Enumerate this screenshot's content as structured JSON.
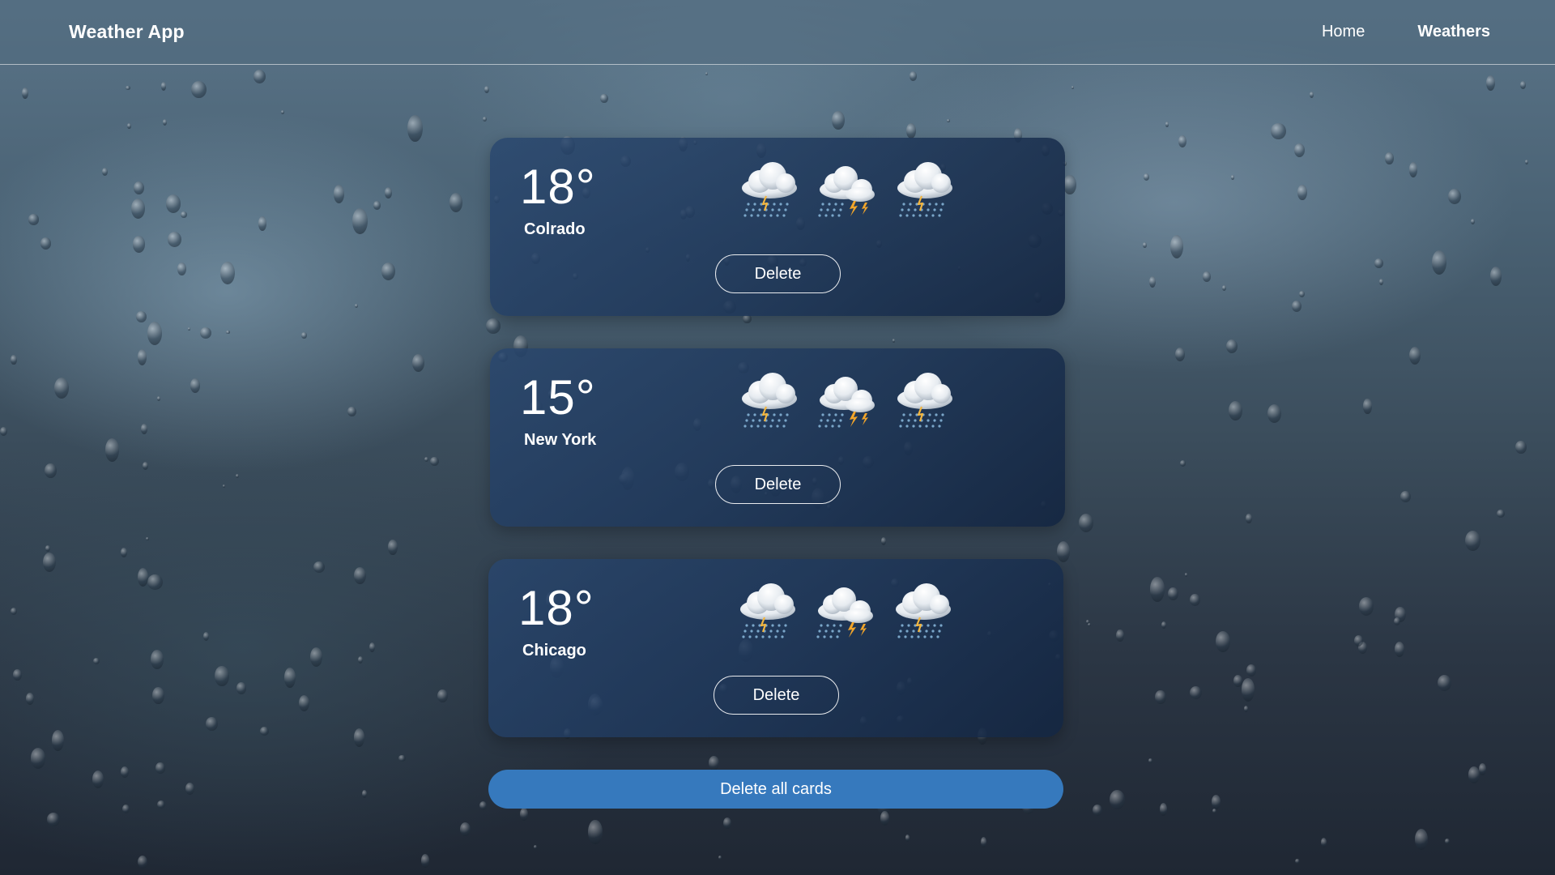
{
  "header": {
    "brand": "Weather App",
    "nav": [
      {
        "label": "Home",
        "active": false
      },
      {
        "label": "Weathers",
        "active": true
      }
    ]
  },
  "cards": [
    {
      "temp": "18°",
      "city": "Colrado",
      "icons": [
        "rain-icon",
        "thunderstorm-icon",
        "rain-icon"
      ],
      "delete_label": "Delete"
    },
    {
      "temp": "15°",
      "city": "New York",
      "icons": [
        "rain-icon",
        "thunderstorm-icon",
        "rain-icon"
      ],
      "delete_label": "Delete"
    },
    {
      "temp": "18°",
      "city": "Chicago",
      "icons": [
        "rain-icon",
        "thunderstorm-icon",
        "rain-icon"
      ],
      "delete_label": "Delete"
    }
  ],
  "delete_all_label": "Delete all cards",
  "colors": {
    "card": "#223e66",
    "accent_button": "#3679bd",
    "header": "#50697d"
  }
}
